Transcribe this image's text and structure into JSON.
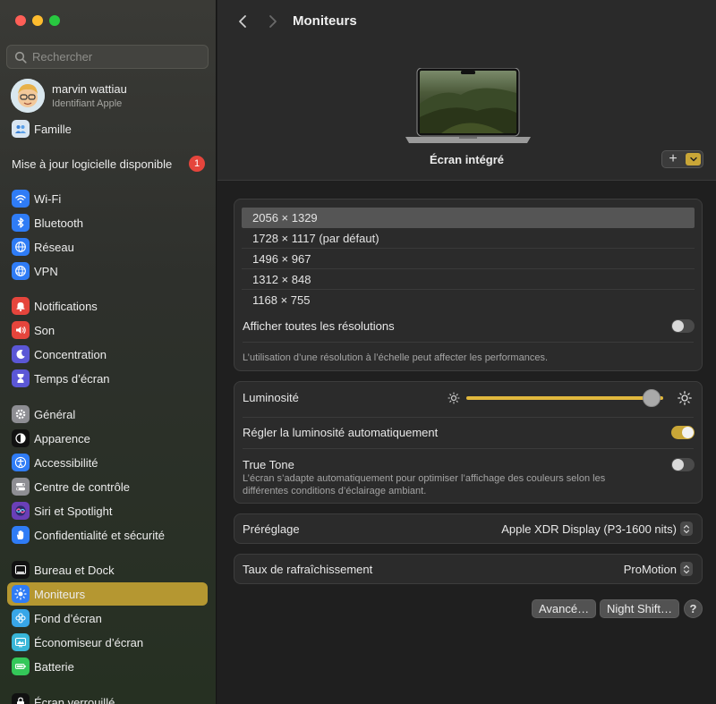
{
  "search": {
    "placeholder": "Rechercher"
  },
  "account": {
    "name": "marvin wattiau",
    "subtitle": "Identifiant Apple"
  },
  "family": {
    "label": "Famille"
  },
  "update": {
    "label": "Mise à jour logicielle disponible",
    "count": "1"
  },
  "sidebar": {
    "items": [
      {
        "label": "Wi-Fi",
        "icon": "wifi-icon",
        "color": "#2f7cf6"
      },
      {
        "label": "Bluetooth",
        "icon": "bluetooth-icon",
        "color": "#2f7cf6"
      },
      {
        "label": "Réseau",
        "icon": "globe-icon",
        "color": "#2f7cf6"
      },
      {
        "label": "VPN",
        "icon": "vpn-globe-icon",
        "color": "#2f7cf6"
      },
      {
        "label": "Notifications",
        "icon": "bell-icon",
        "color": "#e5453c"
      },
      {
        "label": "Son",
        "icon": "speaker-icon",
        "color": "#e5453c"
      },
      {
        "label": "Concentration",
        "icon": "moon-icon",
        "color": "#5b57d6"
      },
      {
        "label": "Temps d’écran",
        "icon": "hourglass-icon",
        "color": "#5b57d6"
      },
      {
        "label": "Général",
        "icon": "gear-icon",
        "color": "#8e8e93"
      },
      {
        "label": "Apparence",
        "icon": "appearance-icon",
        "color": "#111111"
      },
      {
        "label": "Accessibilité",
        "icon": "accessibility-icon",
        "color": "#2f7cf6"
      },
      {
        "label": "Centre de contrôle",
        "icon": "toggles-icon",
        "color": "#8e8e93"
      },
      {
        "label": "Siri et Spotlight",
        "icon": "siri-icon",
        "color": "#6a3fb8"
      },
      {
        "label": "Confidentialité et sécurité",
        "icon": "hand-icon",
        "color": "#2f7cf6"
      },
      {
        "label": "Bureau et Dock",
        "icon": "dock-icon",
        "color": "#111111"
      },
      {
        "label": "Moniteurs",
        "icon": "sun-display-icon",
        "color": "#2f7cf6"
      },
      {
        "label": "Fond d’écran",
        "icon": "flower-icon",
        "color": "#38a6e8"
      },
      {
        "label": "Économiseur d’écran",
        "icon": "screensaver-icon",
        "color": "#38b6d8"
      },
      {
        "label": "Batterie",
        "icon": "battery-icon",
        "color": "#34c759"
      },
      {
        "label": "Écran verrouillé",
        "icon": "lock-icon",
        "color": "#111111"
      }
    ],
    "active": "Moniteurs"
  },
  "header": {
    "title": "Moniteurs"
  },
  "display": {
    "name": "Écran intégré",
    "add_label": "+"
  },
  "resolutions": {
    "options": [
      "2056 × 1329",
      "1728 × 1117 (par défaut)",
      "1496 × 967",
      "1312 × 848",
      "1168 × 755"
    ],
    "selected_index": 0,
    "show_all_label": "Afficher toutes les résolutions",
    "show_all_on": false,
    "note": "L’utilisation d’une résolution à l’échelle peut affecter les performances."
  },
  "brightness": {
    "label": "Luminosité",
    "level": 0.94,
    "auto_label": "Régler la luminosité automatiquement",
    "auto_on": true,
    "truetone_label": "True Tone",
    "truetone_on": false,
    "truetone_desc": "L’écran s’adapte automatiquement pour optimiser l’affichage des couleurs selon les différentes conditions d’éclairage ambiant."
  },
  "preset": {
    "label": "Préréglage",
    "value": "Apple XDR Display (P3-1600 nits)"
  },
  "refresh": {
    "label": "Taux de rafraîchissement",
    "value": "ProMotion"
  },
  "buttons": {
    "advanced": "Avancé…",
    "night_shift": "Night Shift…",
    "help": "?"
  },
  "colors": {
    "accent": "#c9a637",
    "sidebar_active": "#b59731",
    "badge": "#e5453c"
  }
}
